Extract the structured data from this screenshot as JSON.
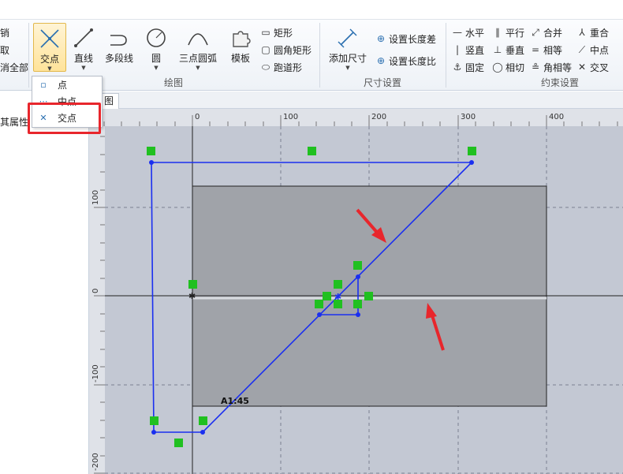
{
  "left_cut": [
    "销",
    "取",
    "消全部"
  ],
  "draw_group": {
    "label": "绘图",
    "buttons": [
      {
        "label": "交点",
        "icon": "intersection-point-icon"
      },
      {
        "label": "直线",
        "icon": "line-icon"
      },
      {
        "label": "多段线",
        "icon": "polyline-icon"
      },
      {
        "label": "圆",
        "icon": "circle-icon"
      },
      {
        "label": "三点圆弧",
        "icon": "three-point-arc-icon"
      },
      {
        "label": "模板",
        "icon": "template-icon"
      }
    ],
    "shapes": [
      {
        "label": "矩形",
        "icon": "rectangle-icon"
      },
      {
        "label": "圆角矩形",
        "icon": "rounded-rectangle-icon"
      },
      {
        "label": "跑道形",
        "icon": "racetrack-icon"
      }
    ]
  },
  "dimension_group": {
    "label": "尺寸设置",
    "add_dimension": "添加尺寸",
    "set_length_diff": "设置长度差",
    "set_length_ratio": "设置长度比"
  },
  "constraint_group": {
    "label": "约束设置",
    "items": [
      {
        "label": "水平",
        "icon": "horizontal-icon"
      },
      {
        "label": "平行",
        "icon": "parallel-icon"
      },
      {
        "label": "合并",
        "icon": "merge-icon"
      },
      {
        "label": "重合",
        "icon": "coincident-icon"
      },
      {
        "label": "竖直",
        "icon": "vertical-icon"
      },
      {
        "label": "垂直",
        "icon": "perpendicular-icon"
      },
      {
        "label": "相等",
        "icon": "equal-icon"
      },
      {
        "label": "中点",
        "icon": "midpoint-icon"
      },
      {
        "label": "固定",
        "icon": "anchor-icon"
      },
      {
        "label": "相切",
        "icon": "tangent-icon"
      },
      {
        "label": "角相等",
        "icon": "equal-angle-icon"
      },
      {
        "label": "交叉",
        "icon": "cross-icon"
      }
    ]
  },
  "dropdown": {
    "items": [
      {
        "label": "点",
        "icon": "point-icon"
      },
      {
        "label": "中点",
        "icon": "midpoint-icon"
      },
      {
        "label": "交点",
        "icon": "intersection-icon"
      }
    ]
  },
  "left_panel": {
    "label": "其属性"
  },
  "doc_tab": {
    "label": "图"
  },
  "ruler": {
    "h_labels": [
      "0",
      "100",
      "200",
      "300",
      "400"
    ],
    "v_labels": [
      "100",
      "0",
      "-100",
      "-200"
    ]
  },
  "canvas_text": {
    "dimension": "A1:45"
  },
  "colors": {
    "canvas_bg": "#c3c8d3",
    "region_fill": "#a0a3a9",
    "sketch_line": "#1a2ff0",
    "constraint_badge": "#20c020",
    "highlight": "#e8262c"
  }
}
